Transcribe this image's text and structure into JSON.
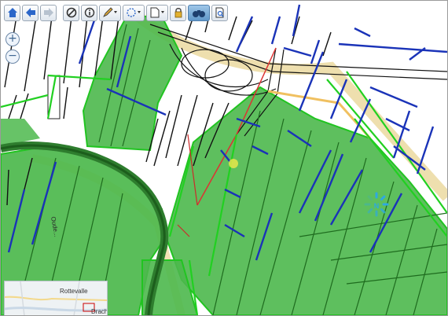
{
  "toolbar": {
    "buttons": [
      {
        "name": "home-button",
        "icon": "home-icon"
      },
      {
        "name": "back-button",
        "icon": "arrow-left-icon"
      },
      {
        "name": "forward-button",
        "icon": "arrow-right-icon"
      },
      {
        "name": "clear-button",
        "icon": "no-entry-icon"
      },
      {
        "name": "info-button",
        "icon": "info-icon"
      },
      {
        "name": "draw-tool-button",
        "icon": "pencil-icon"
      },
      {
        "name": "select-tool-button",
        "icon": "dashed-circle-icon"
      },
      {
        "name": "export-button",
        "icon": "document-icon"
      },
      {
        "name": "lock-button",
        "icon": "lock-icon"
      },
      {
        "name": "binoculars-button",
        "icon": "binoculars-icon"
      },
      {
        "name": "search-document-button",
        "icon": "magnifier-document-icon"
      }
    ]
  },
  "zoom": {
    "in_label": "+",
    "out_label": "−"
  },
  "map": {
    "street_label": "Oude...",
    "colors": {
      "parcel_fill": "#4cb84c",
      "parcel_border": "#22c422",
      "ditch": "#1a33b8",
      "road": "#f1d27a"
    }
  },
  "overview_map": {
    "labels": [
      "Rottevalle",
      "Drach"
    ]
  }
}
